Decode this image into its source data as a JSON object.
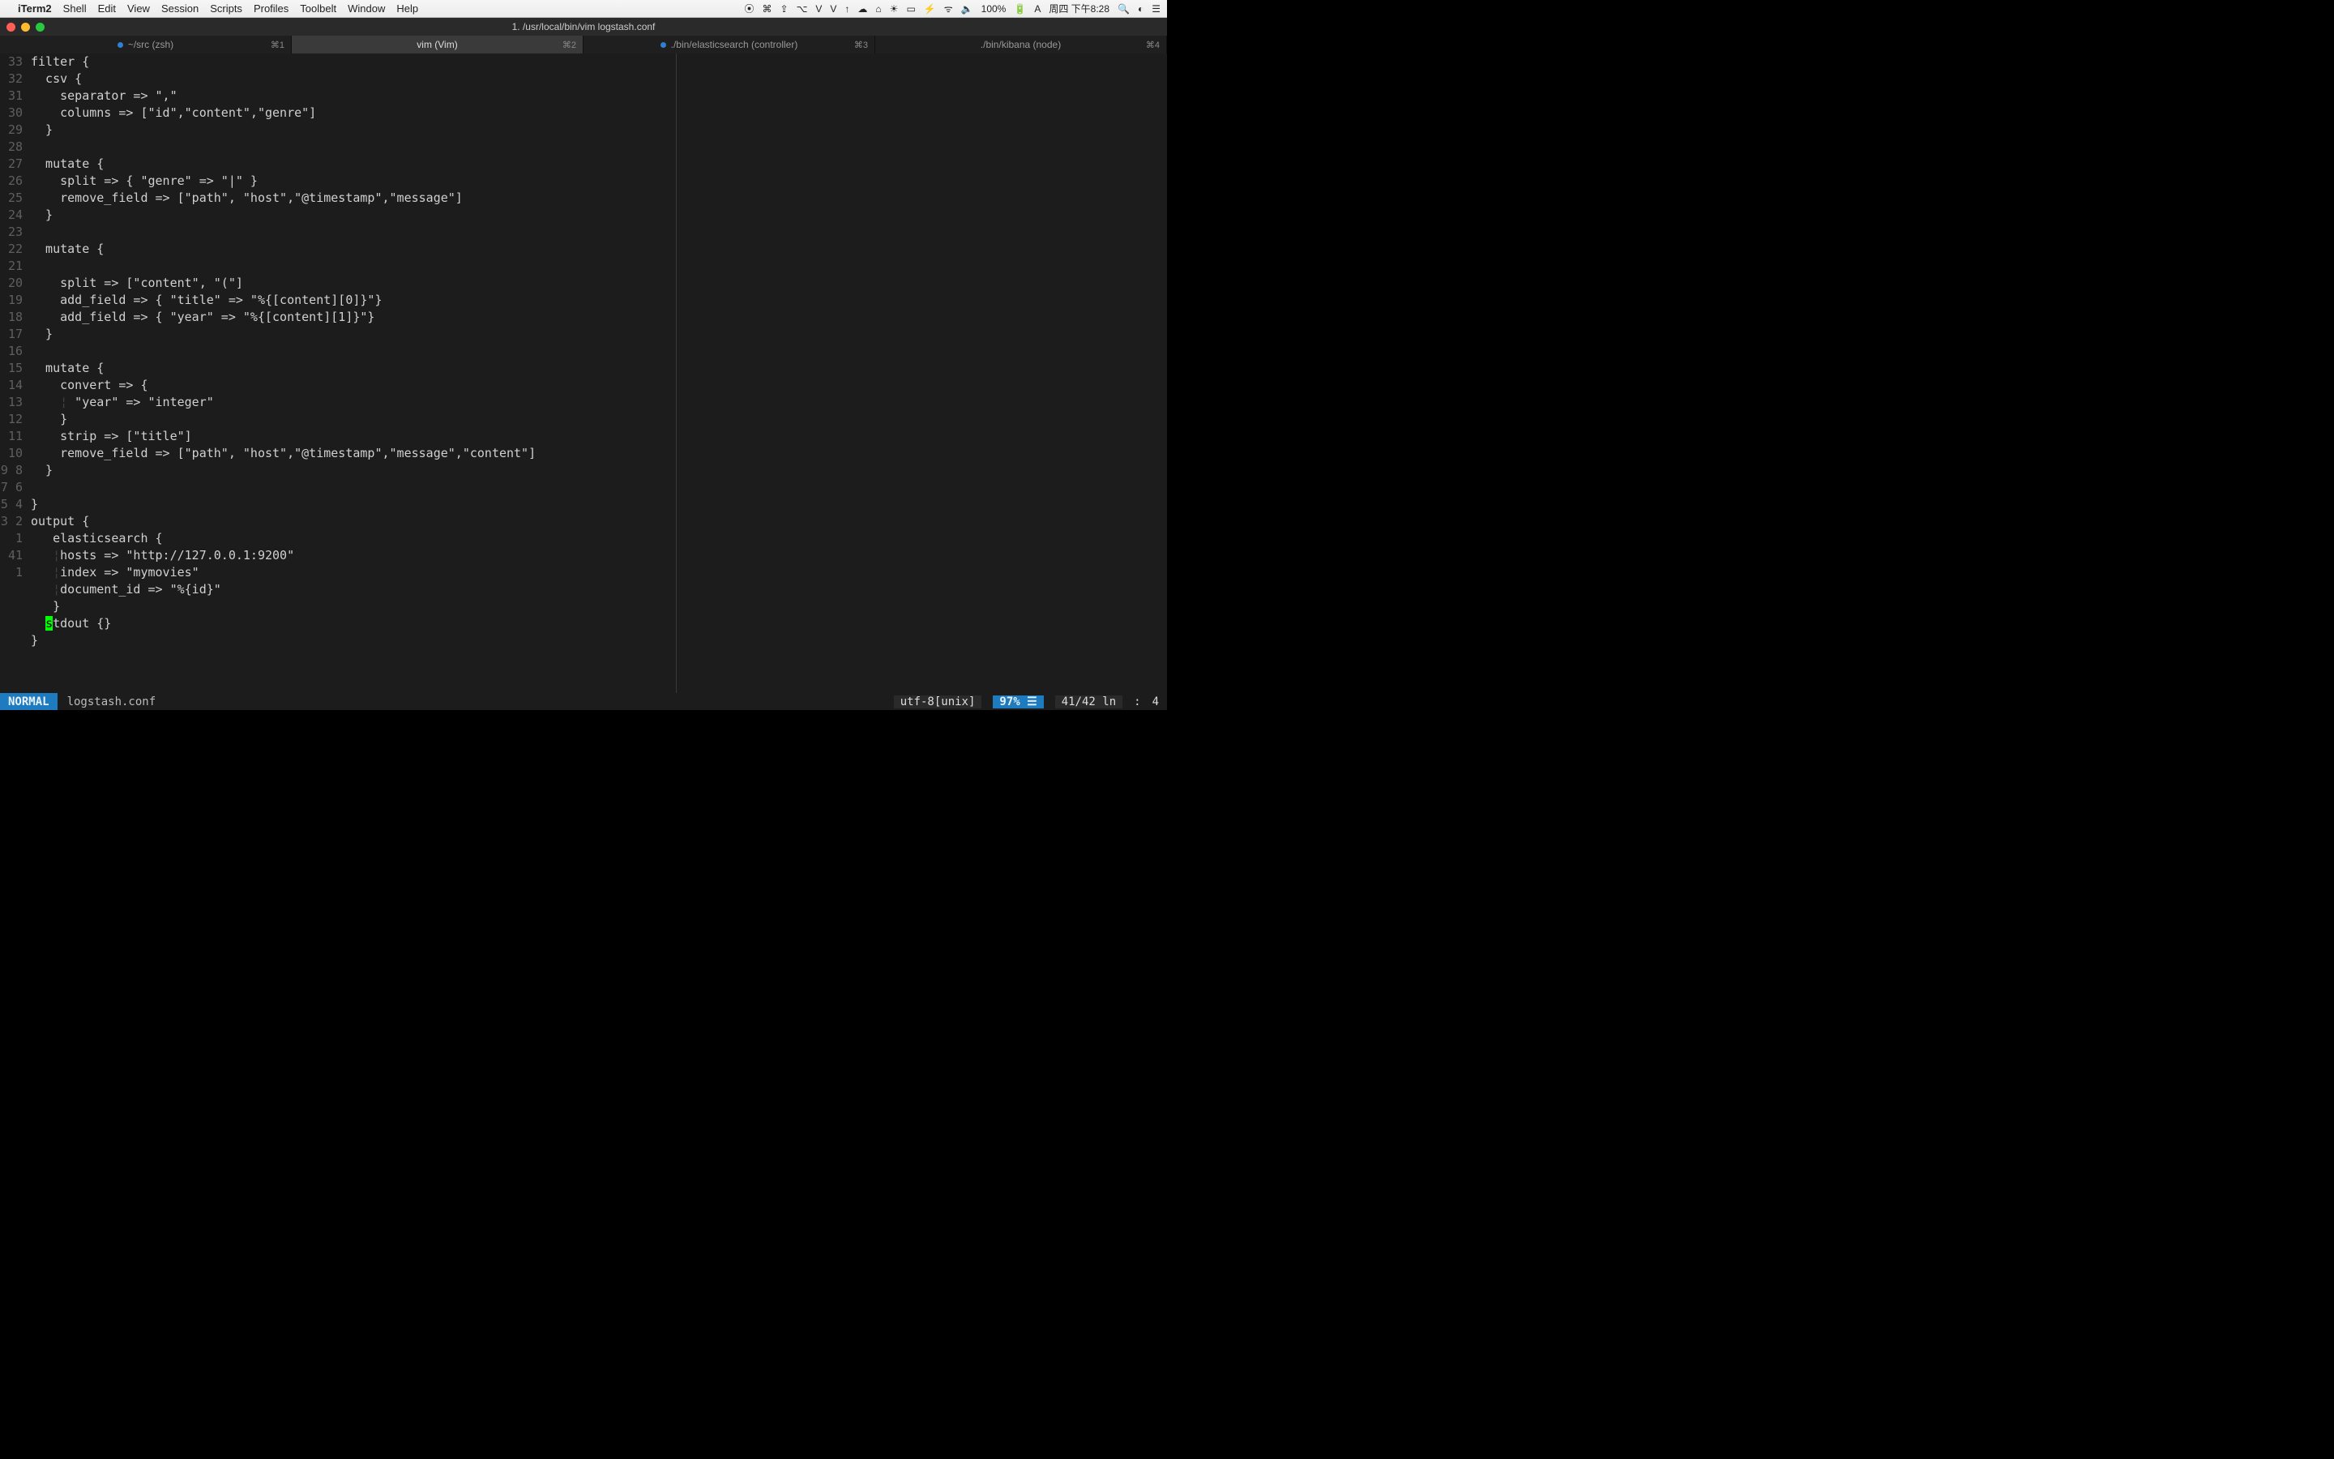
{
  "menubar": {
    "apple": "",
    "appname": "iTerm2",
    "items": [
      "Shell",
      "Edit",
      "View",
      "Session",
      "Scripts",
      "Profiles",
      "Toolbelt",
      "Window",
      "Help"
    ],
    "right_icons": [
      "⦿",
      "⌘",
      "⇪",
      "⌥",
      "V",
      "V",
      "↑",
      "☁",
      "⌂",
      "☀",
      "▭",
      "⚡",
      "ᯤ",
      "🔈",
      "100%",
      "🔋",
      "A"
    ],
    "clock": "周四 下午8:28",
    "right_tail": [
      "🔍",
      "◐",
      "☰"
    ]
  },
  "window": {
    "title": "1. /usr/local/bin/vim logstash.conf"
  },
  "tabs": [
    {
      "label": "~/src (zsh)",
      "shortcut": "⌘1",
      "dot": true,
      "active": false
    },
    {
      "label": "vim (Vim)",
      "shortcut": "⌘2",
      "dot": false,
      "active": true
    },
    {
      "label": "./bin/elasticsearch (controller)",
      "shortcut": "⌘3",
      "dot": true,
      "active": false
    },
    {
      "label": "./bin/kibana (node)",
      "shortcut": "⌘4",
      "dot": false,
      "active": false
    }
  ],
  "editor": {
    "cursor": {
      "abs_line": 41,
      "display_row_index": 33,
      "col": 3
    },
    "gutter": [
      "33",
      "32",
      "31",
      "30",
      "29",
      "28",
      "27",
      "26",
      "25",
      "24",
      "23",
      "22",
      "21",
      "20",
      "19",
      "18",
      "17",
      "16",
      "15",
      "14",
      "13",
      "12",
      "11",
      "10",
      "9",
      "8",
      "7",
      "6",
      "5",
      "4",
      "3",
      "2",
      "1",
      "41",
      "1"
    ],
    "lines": [
      "filter {",
      "  csv {",
      "    separator => \",\"",
      "    columns => [\"id\",\"content\",\"genre\"]",
      "  }",
      "",
      "  mutate {",
      "    split => { \"genre\" => \"|\" }",
      "    remove_field => [\"path\", \"host\",\"@timestamp\",\"message\"]",
      "  }",
      "",
      "  mutate {",
      "",
      "    split => [\"content\", \"(\"]",
      "    add_field => { \"title\" => \"%{[content][0]}\"}",
      "    add_field => { \"year\" => \"%{[content][1]}\"}",
      "  }",
      "",
      "  mutate {",
      "    convert => {",
      "    ¦ \"year\" => \"integer\"",
      "    }",
      "    strip => [\"title\"]",
      "    remove_field => [\"path\", \"host\",\"@timestamp\",\"message\",\"content\"]",
      "  }",
      "",
      "}",
      "output {",
      "   elasticsearch {",
      "   ¦hosts => \"http://127.0.0.1:9200\"",
      "   ¦index => \"mymovies\"",
      "   ¦document_id => \"%{id}\"",
      "   }",
      "  stdout {}",
      "}"
    ]
  },
  "statusline": {
    "mode": "NORMAL",
    "file": "logstash.conf",
    "encoding": "utf-8[unix]",
    "percent": "97% ☰",
    "pos": "41/42 ln",
    "col_sep": ":",
    "col": "4"
  }
}
